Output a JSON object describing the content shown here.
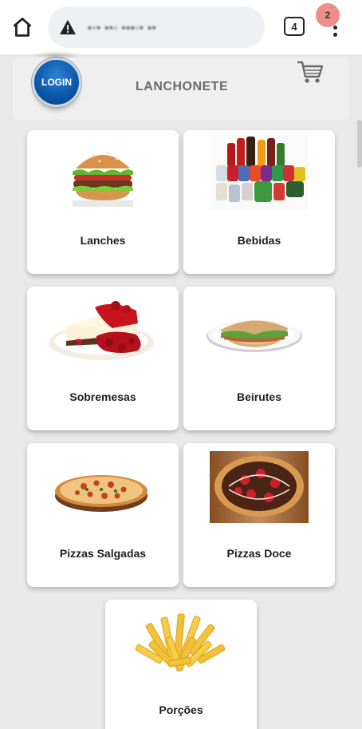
{
  "browser": {
    "url_text": "▪▫• ▪•▫ •▪▪▫• ▪•",
    "tab_count": "4",
    "icons": {
      "home": "home-icon",
      "warning": "warning-icon",
      "menu": "more-vert-icon"
    }
  },
  "header": {
    "login_label": "LOGIN",
    "title": "LANCHONETE",
    "cart_count": "2",
    "cart_icon": "shopping-cart-icon",
    "badge_color": "#ef8d8d",
    "login_color": "#0a56a8"
  },
  "categories": [
    {
      "label": "Lanches",
      "icon": "burger-image"
    },
    {
      "label": "Bebidas",
      "icon": "drinks-image"
    },
    {
      "label": "Sobremesas",
      "icon": "cheesecake-image"
    },
    {
      "label": "Beirutes",
      "icon": "beirute-sandwich-image"
    },
    {
      "label": "Pizzas Salgadas",
      "icon": "pizza-image"
    },
    {
      "label": "Pizzas Doce",
      "icon": "sweet-pizza-image"
    },
    {
      "label": "Porções",
      "icon": "fries-image"
    }
  ]
}
